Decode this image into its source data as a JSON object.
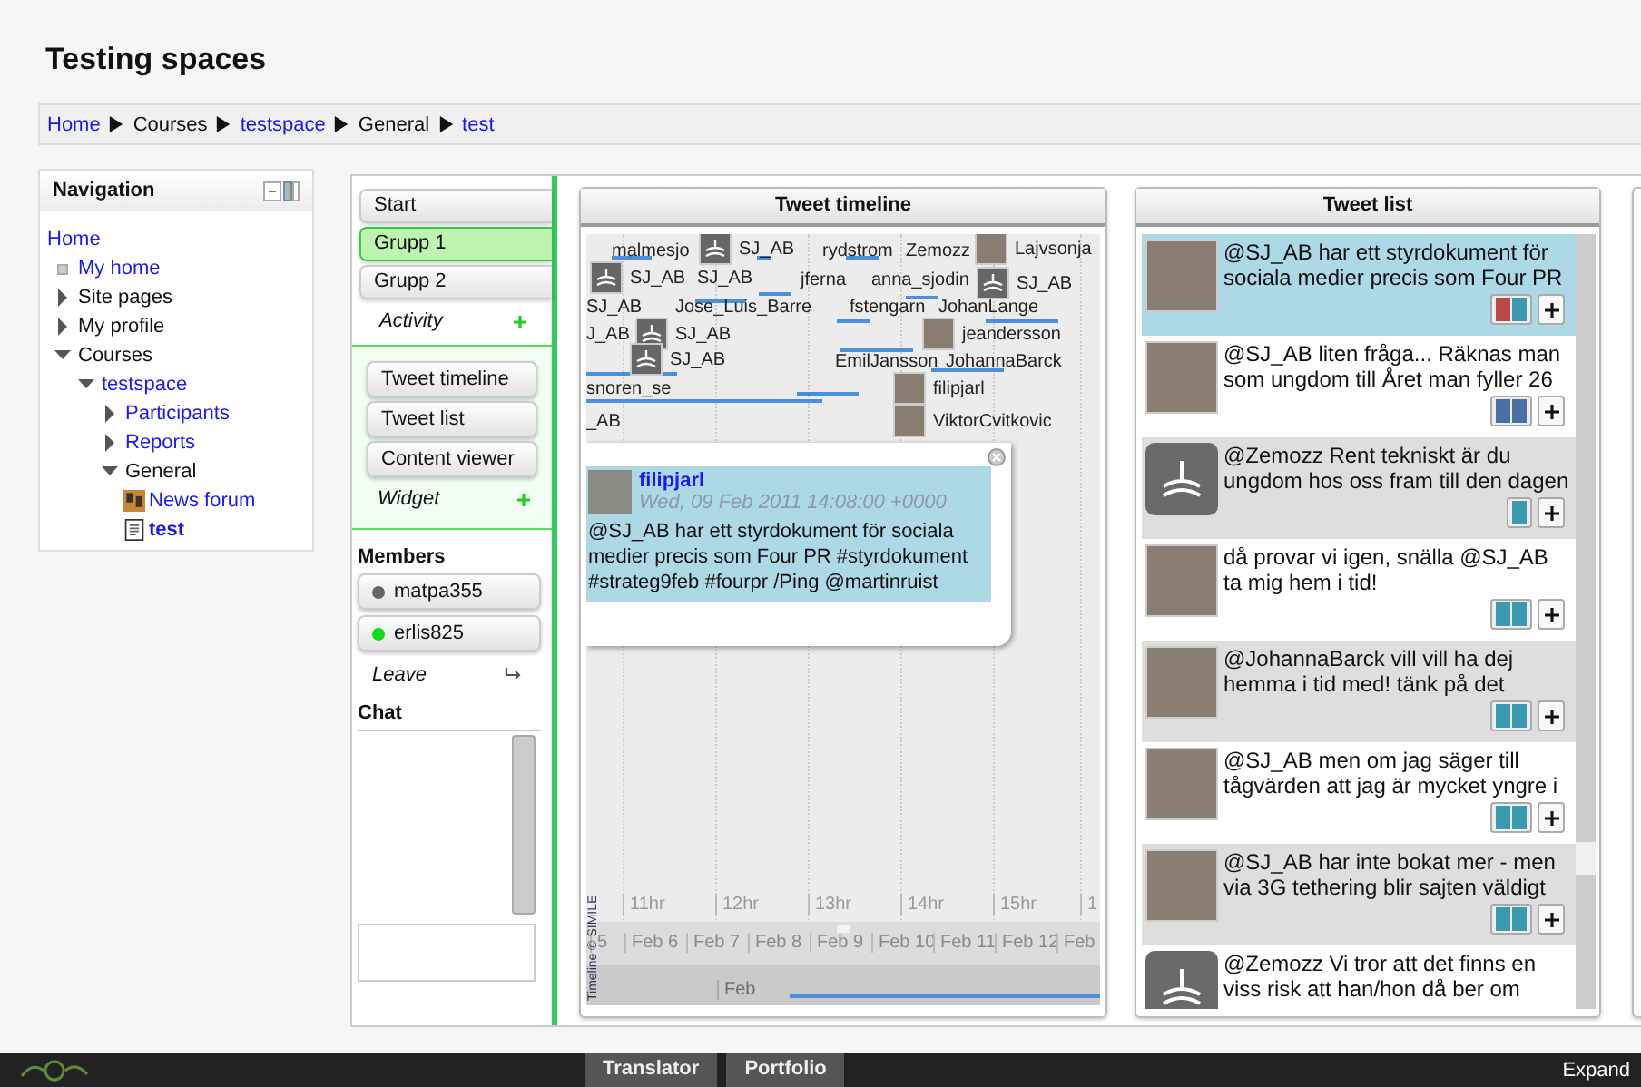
{
  "page_title": "Testing spaces",
  "breadcrumb": [
    {
      "label": "Home",
      "link": true
    },
    {
      "label": "Courses",
      "link": false
    },
    {
      "label": "testspace",
      "link": true
    },
    {
      "label": "General",
      "link": false
    },
    {
      "label": "test",
      "link": true
    }
  ],
  "navigation": {
    "title": "Navigation",
    "items": [
      {
        "label": "Home",
        "kind": "root",
        "link": true,
        "selected": false,
        "children": [
          {
            "label": "My home",
            "kind": "bullet",
            "link": true,
            "selected": false
          },
          {
            "label": "Site pages",
            "kind": "branch",
            "expanded": false,
            "link": false,
            "selected": false
          },
          {
            "label": "My profile",
            "kind": "branch",
            "expanded": false,
            "link": false,
            "selected": false
          },
          {
            "label": "Courses",
            "kind": "branch",
            "expanded": true,
            "link": false,
            "selected": false,
            "children": [
              {
                "label": "testspace",
                "kind": "branch",
                "expanded": true,
                "link": true,
                "selected": false,
                "children": [
                  {
                    "label": "Participants",
                    "kind": "branch",
                    "expanded": false,
                    "link": true,
                    "selected": false
                  },
                  {
                    "label": "Reports",
                    "kind": "branch",
                    "expanded": false,
                    "link": true,
                    "selected": false
                  },
                  {
                    "label": "General",
                    "kind": "branch",
                    "expanded": true,
                    "link": false,
                    "selected": false,
                    "children": [
                      {
                        "label": "News forum",
                        "kind": "forum",
                        "link": true,
                        "selected": false
                      },
                      {
                        "label": "test",
                        "kind": "page",
                        "link": true,
                        "selected": true
                      }
                    ]
                  }
                ]
              }
            ]
          }
        ]
      }
    ]
  },
  "groups": [
    {
      "label": "Start",
      "selected": false
    },
    {
      "label": "Grupp 1",
      "selected": true
    },
    {
      "label": "Grupp 2",
      "selected": false
    }
  ],
  "activity_label": "Activity",
  "widgets": [
    "Tweet timeline",
    "Tweet list",
    "Content viewer"
  ],
  "widget_label": "Widget",
  "members_title": "Members",
  "members": [
    {
      "name": "matpa355",
      "online": false
    },
    {
      "name": "erlis825",
      "online": true
    }
  ],
  "leave_label": "Leave",
  "chat_title": "Chat",
  "timeline": {
    "title": "Tweet timeline",
    "events": [
      {
        "name": "malmesjo",
        "kind": "text"
      },
      {
        "name": "SJ_AB",
        "kind": "logo"
      },
      {
        "name": "rydstrom",
        "kind": "text"
      },
      {
        "name": "Zemozz",
        "kind": "text"
      },
      {
        "name": "Lajvsonja",
        "kind": "photo"
      },
      {
        "name": "SJ_AB",
        "kind": "logo"
      },
      {
        "name": "SJ_AB",
        "kind": "text"
      },
      {
        "name": "jferna",
        "kind": "text"
      },
      {
        "name": "anna_sjodin",
        "kind": "text"
      },
      {
        "name": "SJ_AB",
        "kind": "logo"
      },
      {
        "name": "SJ_AB",
        "kind": "text"
      },
      {
        "name": "Jose_Luis_Barre",
        "kind": "text"
      },
      {
        "name": "fstengarn",
        "kind": "text"
      },
      {
        "name": "JohanLange",
        "kind": "text"
      },
      {
        "name": "J_AB",
        "kind": "text"
      },
      {
        "name": "SJ_AB",
        "kind": "logo"
      },
      {
        "name": "jeandersson",
        "kind": "photo"
      },
      {
        "name": "SJ_AB",
        "kind": "logo"
      },
      {
        "name": "EmilJansson",
        "kind": "text"
      },
      {
        "name": "JohannaBarck",
        "kind": "text"
      },
      {
        "name": "snoren_se",
        "kind": "text"
      },
      {
        "name": "filipjarl",
        "kind": "photo"
      },
      {
        "name": "_AB",
        "kind": "text"
      },
      {
        "name": "ViktorCvitkovic",
        "kind": "photo"
      }
    ],
    "popup": {
      "user": "filipjarl",
      "date": "Wed, 09 Feb 2011 14:08:00 +0000",
      "text": "@SJ_AB har ett styrdokument för sociala medier precis som Four PR #styrdokument #strateg9feb #fourpr /Ping @martinruist"
    },
    "hours": [
      "11hr",
      "12hr",
      "13hr",
      "14hr",
      "15hr",
      "1"
    ],
    "days": [
      "5",
      "Feb 6",
      "Feb 7",
      "Feb 8",
      "Feb 9",
      "Feb 10",
      "Feb 11",
      "Feb 12",
      "Feb"
    ],
    "month": "Feb",
    "credit": "Timeline © SIMILE"
  },
  "tweet_list": {
    "title": "Tweet list",
    "tweets": [
      {
        "text": "@SJ_AB har ett styrdokument för sociala medier precis som Four PR",
        "kind": "photo",
        "selected": true,
        "tags": [
          {
            "color": "#b94a48"
          },
          {
            "color": "#3a9bb0"
          }
        ]
      },
      {
        "text": "@SJ_AB liten fråga... Räknas man som ungdom till Året man fyller 26",
        "kind": "photo",
        "selected": false,
        "tags": [
          {
            "color": "#4a6fa5"
          },
          {
            "color": "#4a6fa5"
          }
        ]
      },
      {
        "text": "@Zemozz Rent tekniskt är du ungdom hos oss fram till den dagen",
        "kind": "logo",
        "selected": false,
        "tags": [
          {
            "color": "#3a9bb0"
          }
        ]
      },
      {
        "text": "då provar vi igen, snälla @SJ_AB ta mig hem i tid!",
        "kind": "photo",
        "selected": false,
        "tags": [
          {
            "color": "#3a9bb0"
          },
          {
            "color": "#3a9bb0"
          }
        ]
      },
      {
        "text": "@JohannaBarck vill vill ha dej hemma i tid med! tänk på det",
        "kind": "photo",
        "selected": false,
        "tags": [
          {
            "color": "#3a9bb0"
          },
          {
            "color": "#3a9bb0"
          }
        ]
      },
      {
        "text": "@SJ_AB men om jag säger till tågvärden att jag är mycket yngre i",
        "kind": "photo",
        "selected": false,
        "tags": [
          {
            "color": "#3a9bb0"
          },
          {
            "color": "#3a9bb0"
          }
        ]
      },
      {
        "text": "@SJ_AB har inte bokat mer - men via 3G tethering blir sajten väldigt",
        "kind": "photo",
        "selected": false,
        "tags": [
          {
            "color": "#3a9bb0"
          },
          {
            "color": "#3a9bb0"
          }
        ]
      },
      {
        "text": "@Zemozz Vi tror att det finns en viss risk att han/hon då ber om",
        "kind": "logo",
        "selected": false
      }
    ]
  },
  "bottom_bar": {
    "tabs": [
      "Translator",
      "Portfolio"
    ],
    "expand": "Expand"
  }
}
